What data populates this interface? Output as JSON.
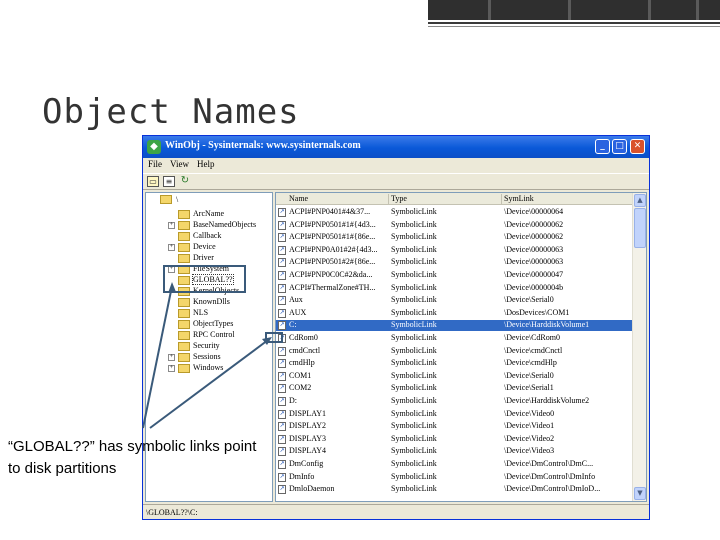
{
  "slide": {
    "title": "Object Names",
    "annotation": "“GLOBAL??” has symbolic links point to disk partitions"
  },
  "window": {
    "title": "WinObj - Sysinternals: www.sysinternals.com",
    "minimize": "_",
    "maximize": "□",
    "close": "✕",
    "menu": [
      "File",
      "View",
      "Help"
    ],
    "status_text": "\\GLOBAL??\\C:"
  },
  "tree": {
    "root": "\\",
    "items": [
      {
        "label": "ArcName",
        "expandable": false
      },
      {
        "label": "BaseNamedObjects",
        "expandable": true
      },
      {
        "label": "Callback",
        "expandable": false
      },
      {
        "label": "Device",
        "expandable": true
      },
      {
        "label": "Driver",
        "expandable": false
      },
      {
        "label": "FileSystem",
        "expandable": true
      },
      {
        "label": "GLOBAL??",
        "expandable": false,
        "selected": true
      },
      {
        "label": "KernelObjects",
        "expandable": false
      },
      {
        "label": "KnownDlls",
        "expandable": false
      },
      {
        "label": "NLS",
        "expandable": false
      },
      {
        "label": "ObjectTypes",
        "expandable": false
      },
      {
        "label": "RPC Control",
        "expandable": false
      },
      {
        "label": "Security",
        "expandable": false
      },
      {
        "label": "Sessions",
        "expandable": true
      },
      {
        "label": "Windows",
        "expandable": true
      }
    ]
  },
  "list": {
    "headers": {
      "name": "Name",
      "type": "Type",
      "symlink": "SymLink"
    },
    "rows": [
      {
        "name": "ACPI#PNP0401#4&37...",
        "type": "SymbolicLink",
        "symlink": "\\Device\\00000064"
      },
      {
        "name": "ACPI#PNP0501#1#{4d3...",
        "type": "SymbolicLink",
        "symlink": "\\Device\\00000062"
      },
      {
        "name": "ACPI#PNP0501#1#{86e...",
        "type": "SymbolicLink",
        "symlink": "\\Device\\00000062"
      },
      {
        "name": "ACPI#PNP0A01#2#{4d3...",
        "type": "SymbolicLink",
        "symlink": "\\Device\\00000063"
      },
      {
        "name": "ACPI#PNP0501#2#{86e...",
        "type": "SymbolicLink",
        "symlink": "\\Device\\00000063"
      },
      {
        "name": "ACPI#PNP0C0C#2&da...",
        "type": "SymbolicLink",
        "symlink": "\\Device\\00000047"
      },
      {
        "name": "ACPI#ThermalZone#TH...",
        "type": "SymbolicLink",
        "symlink": "\\Device\\0000004b"
      },
      {
        "name": "Aux",
        "type": "SymbolicLink",
        "symlink": "\\Device\\Serial0"
      },
      {
        "name": "AUX",
        "type": "SymbolicLink",
        "symlink": "\\DosDevices\\COM1"
      },
      {
        "name": "C:",
        "type": "SymbolicLink",
        "symlink": "\\Device\\HarddiskVolume1",
        "selected": true
      },
      {
        "name": "CdRom0",
        "type": "SymbolicLink",
        "symlink": "\\Device\\CdRom0"
      },
      {
        "name": "cmdCnctl",
        "type": "SymbolicLink",
        "symlink": "\\Device\\cmdCnctl"
      },
      {
        "name": "cmdHlp",
        "type": "SymbolicLink",
        "symlink": "\\Device\\cmdHlp"
      },
      {
        "name": "COM1",
        "type": "SymbolicLink",
        "symlink": "\\Device\\Serial0"
      },
      {
        "name": "COM2",
        "type": "SymbolicLink",
        "symlink": "\\Device\\Serial1"
      },
      {
        "name": "D:",
        "type": "SymbolicLink",
        "symlink": "\\Device\\HarddiskVolume2"
      },
      {
        "name": "DISPLAY1",
        "type": "SymbolicLink",
        "symlink": "\\Device\\Video0"
      },
      {
        "name": "DISPLAY2",
        "type": "SymbolicLink",
        "symlink": "\\Device\\Video1"
      },
      {
        "name": "DISPLAY3",
        "type": "SymbolicLink",
        "symlink": "\\Device\\Video2"
      },
      {
        "name": "DISPLAY4",
        "type": "SymbolicLink",
        "symlink": "\\Device\\Video3"
      },
      {
        "name": "DmConfig",
        "type": "SymbolicLink",
        "symlink": "\\Device\\DmControl\\DmC..."
      },
      {
        "name": "DmInfo",
        "type": "SymbolicLink",
        "symlink": "\\Device\\DmControl\\DmInfo"
      },
      {
        "name": "DmloDaemon",
        "type": "SymbolicLink",
        "symlink": "\\Device\\DmControl\\DmIoD..."
      }
    ]
  },
  "colors": {
    "selection": "#316ac5",
    "titlebar": "#0a58d8",
    "callout": "#3a5a7a"
  }
}
